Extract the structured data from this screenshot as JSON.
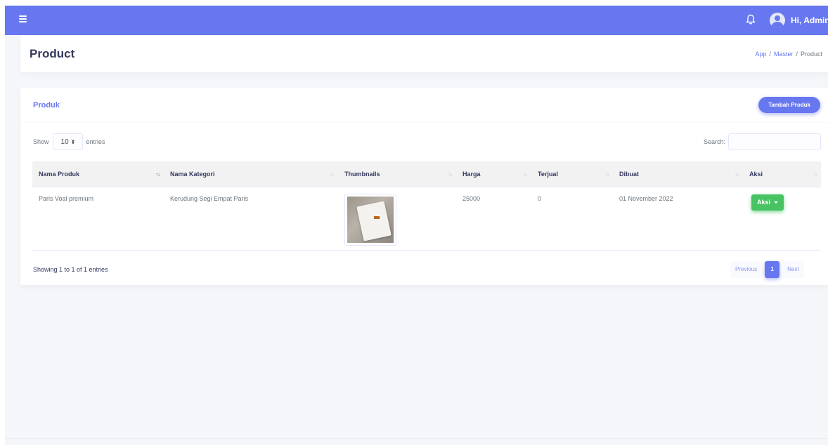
{
  "topbar": {
    "user_greeting": "Hi, Admin"
  },
  "header": {
    "title": "Product",
    "breadcrumb": [
      "App",
      "Master",
      "Product"
    ]
  },
  "card": {
    "title": "Produk",
    "add_button": "Tambah Produk"
  },
  "table_controls": {
    "show_label": "Show",
    "entries_label": "entries",
    "page_length": "10",
    "search_label": "Search:",
    "search_value": ""
  },
  "table": {
    "columns": [
      "Nama Produk",
      "Nama Kategori",
      "Thumbnails",
      "Harga",
      "Terjual",
      "Dibuat",
      "Aksi"
    ],
    "rows": [
      {
        "nama_produk": "Paris Voal premium",
        "nama_kategori": "Kerudung Segi Empat Paris",
        "harga": "25000",
        "terjual": "0",
        "dibuat": "01 November 2022",
        "aksi": "Aksi"
      }
    ]
  },
  "pagination": {
    "info": "Showing 1 to 1 of 1 entries",
    "previous": "Previous",
    "current": "1",
    "next": "Next"
  },
  "colors": {
    "primary": "#6777ef",
    "success": "#47c363"
  }
}
